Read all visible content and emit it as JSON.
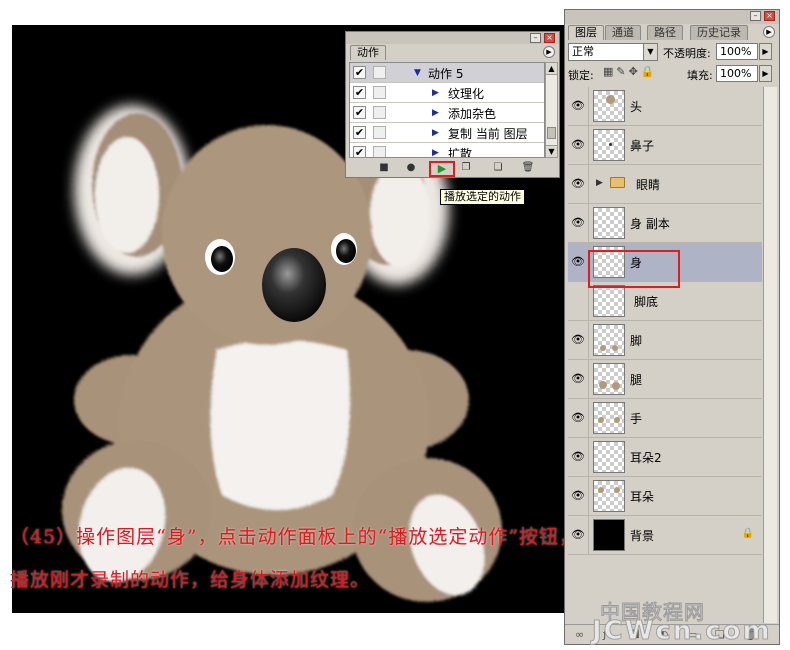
{
  "caption": {
    "line1": "（45）操作图层“身”，点击动作面板上的“播放选定动作”按钮，",
    "line2": "播放刚才录制的动作，给身体添加纹理。"
  },
  "actions_panel": {
    "tab": "动作",
    "items": [
      {
        "label": "动作 5",
        "checked": "✔",
        "expanded": true
      },
      {
        "label": "纹理化",
        "checked": "✔"
      },
      {
        "label": "添加杂色",
        "checked": "✔"
      },
      {
        "label": "复制 当前 图层",
        "checked": "✔"
      },
      {
        "label": "扩散",
        "checked": "✔"
      }
    ],
    "toolbar": {
      "stop": "■",
      "record": "●",
      "play": "▶",
      "new_set": "❐",
      "new_action": "❏",
      "delete": "🗑"
    },
    "tooltip": "播放选定的动作"
  },
  "layers_panel": {
    "tabs": [
      "图层",
      "通道",
      "路径",
      "历史记录"
    ],
    "blend_mode": "正常",
    "opacity_label": "不透明度:",
    "opacity_value": "100%",
    "lock_label": "锁定:",
    "fill_label": "填充:",
    "fill_value": "100%",
    "layers": [
      {
        "name": "头"
      },
      {
        "name": "鼻子"
      },
      {
        "name": "眼睛",
        "type": "group"
      },
      {
        "name": "身 副本"
      },
      {
        "name": "身",
        "selected": true
      },
      {
        "name": "脚底"
      },
      {
        "name": "脚"
      },
      {
        "name": "腿"
      },
      {
        "name": "手"
      },
      {
        "name": "耳朵2"
      },
      {
        "name": "耳朵"
      },
      {
        "name": "背景",
        "locked": true
      }
    ],
    "bottom_icons": [
      "link-icon",
      "layer-style-icon",
      "mask-icon",
      "adjustment-icon",
      "folder-icon",
      "new-layer-icon",
      "trash-icon"
    ]
  },
  "watermark": {
    "line1": "中国教程网",
    "line2": "JCWcn.com"
  },
  "colors": {
    "caption": "#e8141a",
    "highlight": "#e31b1b",
    "selected_row": "#aeb3c6",
    "koala_fur": "#a9927a"
  }
}
